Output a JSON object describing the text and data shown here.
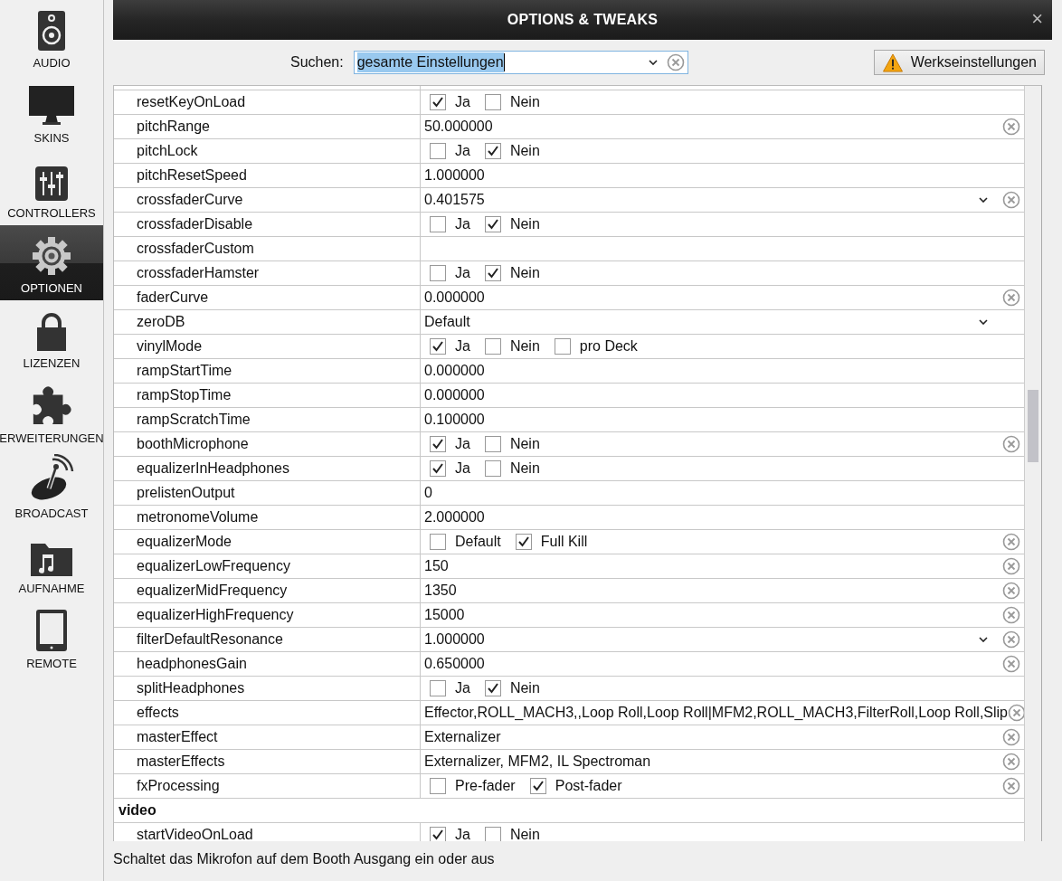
{
  "sidebar": {
    "items": [
      {
        "label": "AUDIO",
        "selected": false
      },
      {
        "label": "SKINS",
        "selected": false
      },
      {
        "label": "CONTROLLERS",
        "selected": false
      },
      {
        "label": "OPTIONEN",
        "selected": true
      },
      {
        "label": "LIZENZEN",
        "selected": false
      },
      {
        "label": "ERWEITERUNGEN",
        "selected": false
      },
      {
        "label": "BROADCAST",
        "selected": false
      },
      {
        "label": "AUFNAHME",
        "selected": false
      },
      {
        "label": "REMOTE",
        "selected": false
      }
    ]
  },
  "window": {
    "title": "OPTIONS & TWEAKS",
    "close": "×"
  },
  "search": {
    "label": "Suchen:",
    "value": "gesamte Einstellungen"
  },
  "reset_button": {
    "label": "Werkseinstellungen"
  },
  "table": {
    "rows": [
      {
        "kind": "checks",
        "name": "resetKeyOnLoad",
        "options": [
          {
            "label": "Ja",
            "checked": true
          },
          {
            "label": "Nein",
            "checked": false
          }
        ]
      },
      {
        "kind": "text",
        "name": "pitchRange",
        "value": "50.000000",
        "clear": true
      },
      {
        "kind": "checks",
        "name": "pitchLock",
        "options": [
          {
            "label": "Ja",
            "checked": false
          },
          {
            "label": "Nein",
            "checked": true
          }
        ]
      },
      {
        "kind": "text",
        "name": "pitchResetSpeed",
        "value": "1.000000"
      },
      {
        "kind": "text",
        "name": "crossfaderCurve",
        "value": "0.401575",
        "dropdown": true,
        "clear": true
      },
      {
        "kind": "checks",
        "name": "crossfaderDisable",
        "options": [
          {
            "label": "Ja",
            "checked": false
          },
          {
            "label": "Nein",
            "checked": true
          }
        ]
      },
      {
        "kind": "text",
        "name": "crossfaderCustom"
      },
      {
        "kind": "checks",
        "name": "crossfaderHamster",
        "options": [
          {
            "label": "Ja",
            "checked": false
          },
          {
            "label": "Nein",
            "checked": true
          }
        ]
      },
      {
        "kind": "text",
        "name": "faderCurve",
        "value": "0.000000",
        "clear": true
      },
      {
        "kind": "text",
        "name": "zeroDB",
        "value": "Default",
        "dropdown": true
      },
      {
        "kind": "checks",
        "name": "vinylMode",
        "options": [
          {
            "label": "Ja",
            "checked": true
          },
          {
            "label": "Nein",
            "checked": false
          },
          {
            "label": "pro Deck",
            "checked": false
          }
        ]
      },
      {
        "kind": "text",
        "name": "rampStartTime",
        "value": "0.000000"
      },
      {
        "kind": "text",
        "name": "rampStopTime",
        "value": "0.000000"
      },
      {
        "kind": "text",
        "name": "rampScratchTime",
        "value": "0.100000"
      },
      {
        "kind": "checks",
        "name": "boothMicrophone",
        "options": [
          {
            "label": "Ja",
            "checked": true
          },
          {
            "label": "Nein",
            "checked": false
          }
        ],
        "clear": true
      },
      {
        "kind": "checks",
        "name": "equalizerInHeadphones",
        "options": [
          {
            "label": "Ja",
            "checked": true
          },
          {
            "label": "Nein",
            "checked": false
          }
        ]
      },
      {
        "kind": "text",
        "name": "prelistenOutput",
        "value": "0"
      },
      {
        "kind": "text",
        "name": "metronomeVolume",
        "value": "2.000000"
      },
      {
        "kind": "checks",
        "name": "equalizerMode",
        "options": [
          {
            "label": "Default",
            "checked": false
          },
          {
            "label": "Full Kill",
            "checked": true
          }
        ],
        "clear": true
      },
      {
        "kind": "text",
        "name": "equalizerLowFrequency",
        "value": "150",
        "clear": true
      },
      {
        "kind": "text",
        "name": "equalizerMidFrequency",
        "value": "1350",
        "clear": true
      },
      {
        "kind": "text",
        "name": "equalizerHighFrequency",
        "value": "15000",
        "clear": true
      },
      {
        "kind": "text",
        "name": "filterDefaultResonance",
        "value": "1.000000",
        "dropdown": true,
        "clear": true
      },
      {
        "kind": "text",
        "name": "headphonesGain",
        "value": "0.650000",
        "clear": true
      },
      {
        "kind": "checks",
        "name": "splitHeadphones",
        "options": [
          {
            "label": "Ja",
            "checked": false
          },
          {
            "label": "Nein",
            "checked": true
          }
        ]
      },
      {
        "kind": "text",
        "name": "effects",
        "value": "Effector,ROLL_MACH3,,Loop Roll,Loop Roll|MFM2,ROLL_MACH3,FilterRoll,Loop Roll,Slip",
        "clear": true
      },
      {
        "kind": "text",
        "name": "masterEffect",
        "value": "Externalizer",
        "clear": true
      },
      {
        "kind": "text",
        "name": "masterEffects",
        "value": "Externalizer, MFM2, IL Spectroman",
        "clear": true
      },
      {
        "kind": "checks",
        "name": "fxProcessing",
        "options": [
          {
            "label": "Pre-fader",
            "checked": false
          },
          {
            "label": "Post-fader",
            "checked": true
          }
        ],
        "clear": true
      },
      {
        "kind": "section",
        "name": "video"
      },
      {
        "kind": "checks",
        "name": "startVideoOnLoad",
        "options": [
          {
            "label": "Ja",
            "checked": true
          },
          {
            "label": "Nein",
            "checked": false
          }
        ]
      }
    ]
  },
  "status_bar": {
    "text": "Schaltet das Mikrofon auf dem Booth Ausgang ein oder aus"
  }
}
